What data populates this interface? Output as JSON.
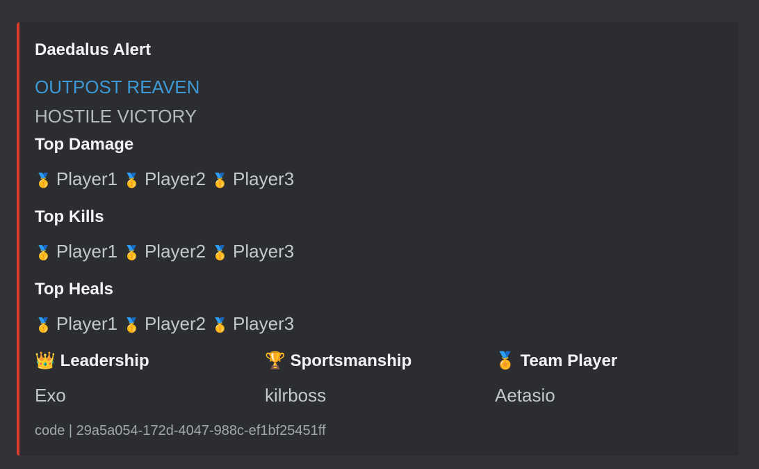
{
  "embed": {
    "title": "Daedalus Alert",
    "location": "OUTPOST REAVEN",
    "result": "HOSTILE VICTORY",
    "accent_color": "#e03a2f",
    "sections": [
      {
        "heading": "Top Damage",
        "medal": "🥇",
        "players": [
          "Player1",
          "Player2",
          "Player3"
        ]
      },
      {
        "heading": "Top Kills",
        "medal": "🥇",
        "players": [
          "Player1",
          "Player2",
          "Player3"
        ]
      },
      {
        "heading": "Top Heals",
        "medal": "🥇",
        "players": [
          "Player1",
          "Player2",
          "Player3"
        ]
      }
    ],
    "awards": [
      {
        "icon": "👑",
        "label": "Leadership",
        "value": "Exo"
      },
      {
        "icon": "🏆",
        "label": "Sportsmanship",
        "value": "kilrboss"
      },
      {
        "icon": "🏅",
        "label": "Team Player",
        "value": "Aetasio"
      }
    ],
    "footer": "code | 29a5a054-172d-4047-988c-ef1bf25451ff"
  }
}
